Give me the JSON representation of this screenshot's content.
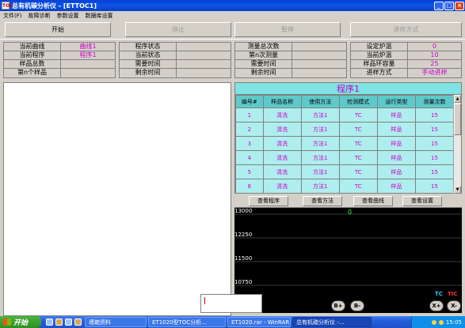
{
  "window": {
    "title": "总有机碳分析仪 - [ETTOC1]",
    "min": "_",
    "max": "□",
    "close": "×",
    "app_icon": "TOC"
  },
  "menu": [
    "文件(F)",
    "故障诊断",
    "参数设置",
    "数据库设置"
  ],
  "toolbar": {
    "start": "开始",
    "stop": "停止",
    "pause": "暂停",
    "sample_mode": "进样方式"
  },
  "status": {
    "group1": [
      {
        "label": "当前曲线",
        "value": "曲线1"
      },
      {
        "label": "当前程序",
        "value": "程序1"
      },
      {
        "label": "样品总数",
        "value": ""
      },
      {
        "label": "第n个样品",
        "value": ""
      }
    ],
    "group2": [
      {
        "label": "程序状态",
        "value": ""
      },
      {
        "label": "当前状态",
        "value": ""
      },
      {
        "label": "需要时间",
        "value": ""
      },
      {
        "label": "剩余时间",
        "value": ""
      }
    ],
    "group3": [
      {
        "label": "测量总次数",
        "value": ""
      },
      {
        "label": "第n次测量",
        "value": ""
      },
      {
        "label": "需要时间",
        "value": ""
      },
      {
        "label": "剩余时间",
        "value": ""
      }
    ],
    "group4": [
      {
        "label": "设定炉温",
        "value": "0"
      },
      {
        "label": "当前炉温",
        "value": "10"
      },
      {
        "label": "样品环容量",
        "value": "25"
      },
      {
        "label": "进样方式",
        "value": "手动进样"
      }
    ]
  },
  "program": {
    "title": "程序1",
    "headers": [
      "编号#",
      "样品名称",
      "使用方法",
      "检测模式",
      "运行类型",
      "测量次数"
    ],
    "rows": [
      [
        "1",
        "清洗",
        "方法1",
        "TC",
        "样品",
        "15"
      ],
      [
        "2",
        "清洗",
        "方法1",
        "TC",
        "样品",
        "15"
      ],
      [
        "3",
        "清洗",
        "方法1",
        "TC",
        "样品",
        "15"
      ],
      [
        "4",
        "清洗",
        "方法1",
        "TC",
        "样品",
        "15"
      ],
      [
        "5",
        "清洗",
        "方法1",
        "TC",
        "样品",
        "15"
      ],
      [
        "6",
        "清洗",
        "方法1",
        "TC",
        "样品",
        "15"
      ]
    ]
  },
  "view_buttons": [
    "查看程序",
    "查看方法",
    "查看曲线",
    "查看设置"
  ],
  "chart": {
    "ticks": [
      "13000",
      "12250",
      "11500",
      "10750"
    ],
    "marker": "0",
    "legend_tc": "TC",
    "legend_tic": "TIC",
    "tc_color": "#33ccff",
    "tic_color": "#ff3333",
    "btn_bplus": "B+",
    "btn_bminus": "B-",
    "btn_xplus": "X+",
    "btn_xminus": "X-"
  },
  "taskbar": {
    "start": "开始",
    "tasks": [
      "墙箱资料",
      "ET1020型TOC分析...",
      "ET1020.rar - WinRAR",
      "总有机碳分析仪 -..."
    ],
    "clock": "15:05"
  }
}
